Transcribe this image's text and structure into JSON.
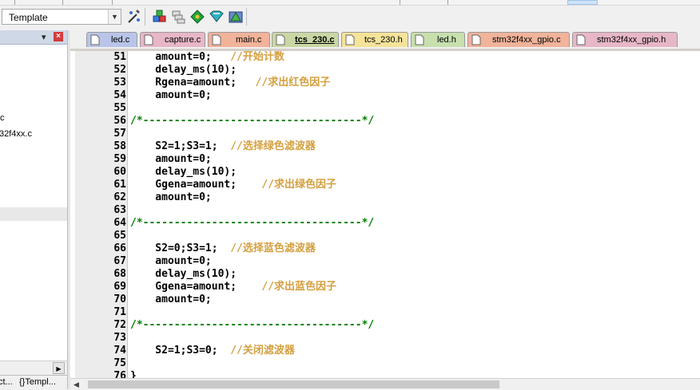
{
  "toolbar": {
    "target_label": "Template",
    "icons": [
      "target-options-icon",
      "manage-components-icon",
      "copy-icon",
      "download-icon",
      "debug-icon",
      "pack-installer-icon"
    ]
  },
  "project_panel": {
    "files": [
      ".c",
      "32f4xx.c"
    ],
    "tabs": [
      "ct...",
      "Templ..."
    ]
  },
  "tabs": [
    {
      "label": "led.c",
      "color": "#b9c4e8"
    },
    {
      "label": "capture.c",
      "color": "#e7b7c7"
    },
    {
      "label": "main.c",
      "color": "#f1b39a"
    },
    {
      "label": "tcs_230.c",
      "color": "#c8d7a4",
      "active": true
    },
    {
      "label": "tcs_230.h",
      "color": "#f5e39a"
    },
    {
      "label": "led.h",
      "color": "#c8dfae"
    },
    {
      "label": "stm32f4xx_gpio.c",
      "color": "#f1b39a"
    },
    {
      "label": "stm32f4xx_gpio.h",
      "color": "#e7b7c7"
    }
  ],
  "code_lines": [
    {
      "n": "51",
      "code": "    amount=0;   ",
      "comment": "//开始计数",
      "sep": ""
    },
    {
      "n": "52",
      "code": "    delay_ms(10);",
      "comment": "",
      "sep": ""
    },
    {
      "n": "53",
      "code": "    Rgena=amount;   ",
      "comment": "//求出红色因子",
      "sep": ""
    },
    {
      "n": "54",
      "code": "    amount=0;",
      "comment": "",
      "sep": ""
    },
    {
      "n": "55",
      "code": "",
      "comment": "",
      "sep": ""
    },
    {
      "n": "56",
      "code": "",
      "comment": "",
      "sep": "/*-----------------------------------*/"
    },
    {
      "n": "57",
      "code": "",
      "comment": "",
      "sep": ""
    },
    {
      "n": "58",
      "code": "    S2=1;S3=1;  ",
      "comment": "//选择绿色滤波器",
      "sep": ""
    },
    {
      "n": "59",
      "code": "    amount=0;",
      "comment": "",
      "sep": ""
    },
    {
      "n": "60",
      "code": "    delay_ms(10);",
      "comment": "",
      "sep": ""
    },
    {
      "n": "61",
      "code": "    Ggena=amount;    ",
      "comment": "//求出绿色因子",
      "sep": ""
    },
    {
      "n": "62",
      "code": "    amount=0;",
      "comment": "",
      "sep": ""
    },
    {
      "n": "63",
      "code": "",
      "comment": "",
      "sep": ""
    },
    {
      "n": "64",
      "code": "",
      "comment": "",
      "sep": "/*-----------------------------------*/"
    },
    {
      "n": "65",
      "code": "",
      "comment": "",
      "sep": ""
    },
    {
      "n": "66",
      "code": "    S2=0;S3=1;  ",
      "comment": "//选择蓝色滤波器",
      "sep": ""
    },
    {
      "n": "67",
      "code": "    amount=0;",
      "comment": "",
      "sep": ""
    },
    {
      "n": "68",
      "code": "    delay_ms(10);",
      "comment": "",
      "sep": ""
    },
    {
      "n": "69",
      "code": "    Ggena=amount;    ",
      "comment": "//求出蓝色因子",
      "sep": ""
    },
    {
      "n": "70",
      "code": "    amount=0;",
      "comment": "",
      "sep": ""
    },
    {
      "n": "71",
      "code": "",
      "comment": "",
      "sep": ""
    },
    {
      "n": "72",
      "code": "",
      "comment": "",
      "sep": "/*-----------------------------------*/"
    },
    {
      "n": "73",
      "code": "",
      "comment": "",
      "sep": ""
    },
    {
      "n": "74",
      "code": "    S2=1;S3=0;  ",
      "comment": "//关闭滤波器",
      "sep": ""
    },
    {
      "n": "75",
      "code": "",
      "comment": "",
      "sep": ""
    },
    {
      "n": "76",
      "code": "}",
      "comment": "",
      "sep": ""
    }
  ]
}
